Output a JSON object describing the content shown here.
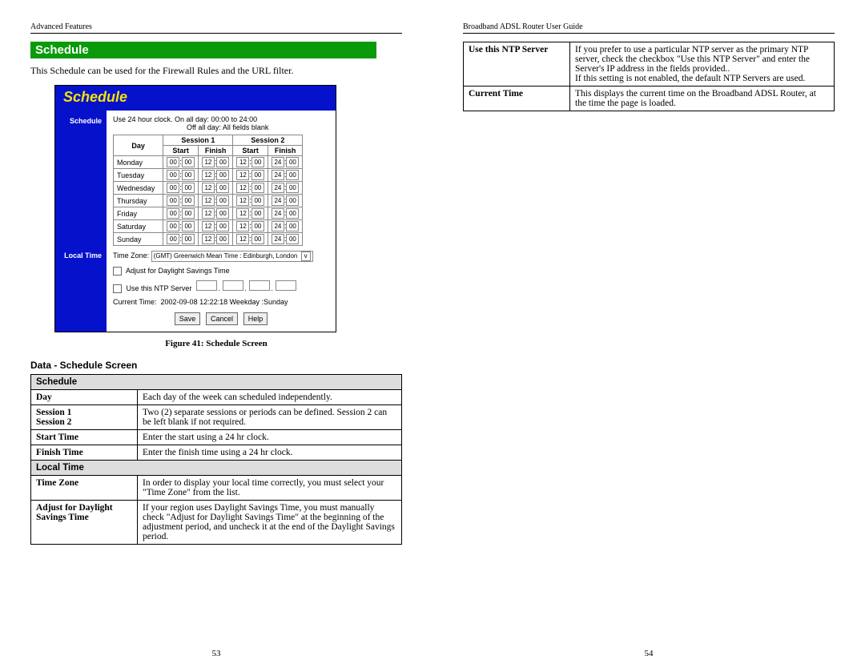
{
  "left": {
    "header": "Advanced Features",
    "section_title": "Schedule",
    "intro": "This Schedule can be used for the Firewall Rules and the URL filter.",
    "shot": {
      "title": "Schedule",
      "nav_schedule": "Schedule",
      "nav_local": "Local Time",
      "instr1": "Use 24 hour clock.   On all day: 00:00 to 24:00",
      "instr2": "Off all day: All fields blank",
      "col_day": "Day",
      "col_s1": "Session 1",
      "col_s2": "Session 2",
      "col_start": "Start",
      "col_finish": "Finish",
      "days": [
        "Monday",
        "Tuesday",
        "Wednesday",
        "Thursday",
        "Friday",
        "Saturday",
        "Sunday"
      ],
      "s1": [
        "00",
        "00",
        "12",
        "00"
      ],
      "s2": [
        "12",
        "00",
        "24",
        "00"
      ],
      "tz_label": "Time Zone:",
      "tz_value": "(GMT) Greenwich Mean Time : Edinburgh, London",
      "adjust_label": "Adjust for Daylight Savings Time",
      "ntp_label": "Use this NTP Server",
      "current_label": "Current Time:",
      "current_value": "2002-09-08 12:22:18  Weekday :Sunday",
      "btn_save": "Save",
      "btn_cancel": "Cancel",
      "btn_help": "Help"
    },
    "fig_caption": "Figure 41: Schedule Screen",
    "data_title": "Data - Schedule Screen",
    "tbl": {
      "grp_schedule": "Schedule",
      "day_k": "Day",
      "day_v": "Each day of the week can scheduled independently.",
      "sess_k": "Session 1\nSession 2",
      "sess_v": "Two (2) separate sessions or periods can be defined. Session 2 can be left blank if not required.",
      "start_k": "Start Time",
      "start_v": "Enter the start using a 24 hr clock.",
      "finish_k": "Finish Time",
      "finish_v": "Enter the finish time using a 24 hr clock.",
      "grp_local": "Local Time",
      "tz_k": "Time Zone",
      "tz_v": "In order to display your local time correctly, you must select your \"Time Zone\" from the list.",
      "adj_k": "Adjust for Daylight Savings Time",
      "adj_v": "If your region uses Daylight Savings Time, you must manually check \"Adjust for Daylight Savings Time\" at the beginning of the adjustment period, and uncheck it at the end of the Daylight Savings period."
    },
    "pageno": "53"
  },
  "right": {
    "header": "Broadband ADSL Router User Guide",
    "tbl": {
      "ntp_k": "Use this NTP Server",
      "ntp_v": "If you prefer to use a particular NTP server as the primary NTP server, check the checkbox \"Use this NTP Server\" and enter the Server's IP address in the fields provided..\nIf this setting is not enabled, the default NTP Servers are used.",
      "cur_k": "Current Time",
      "cur_v": "This displays the current time on the Broadband ADSL Router, at the time the page is loaded."
    },
    "pageno": "54"
  }
}
